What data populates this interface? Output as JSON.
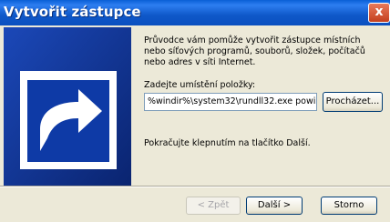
{
  "window": {
    "title": "Vytvořit zástupce",
    "close_symbol": "x"
  },
  "wizard": {
    "intro_text": "Průvodce vám pomůže vytvořit zástupce místních nebo síťových programů, souborů, složek, počítačů nebo adres v síti Internet.",
    "location_label": "Zadejte umístění položky:",
    "location_value": "%windir%\\system32\\rundll32.exe powi",
    "browse_label": "Procházet...",
    "continue_text": "Pokračujte klepnutím na tlačítko Další."
  },
  "buttons": {
    "back_label": "< Zpět",
    "next_label": "Další >",
    "cancel_label": "Storno",
    "back_enabled": false
  },
  "icons": {
    "art_icon": "shortcut-arrow-icon",
    "close_icon": "close-icon"
  },
  "colors": {
    "title_bar": "#0a5fd6",
    "art_background": "#0e2f8c",
    "dialog_background": "#ece9d8"
  }
}
